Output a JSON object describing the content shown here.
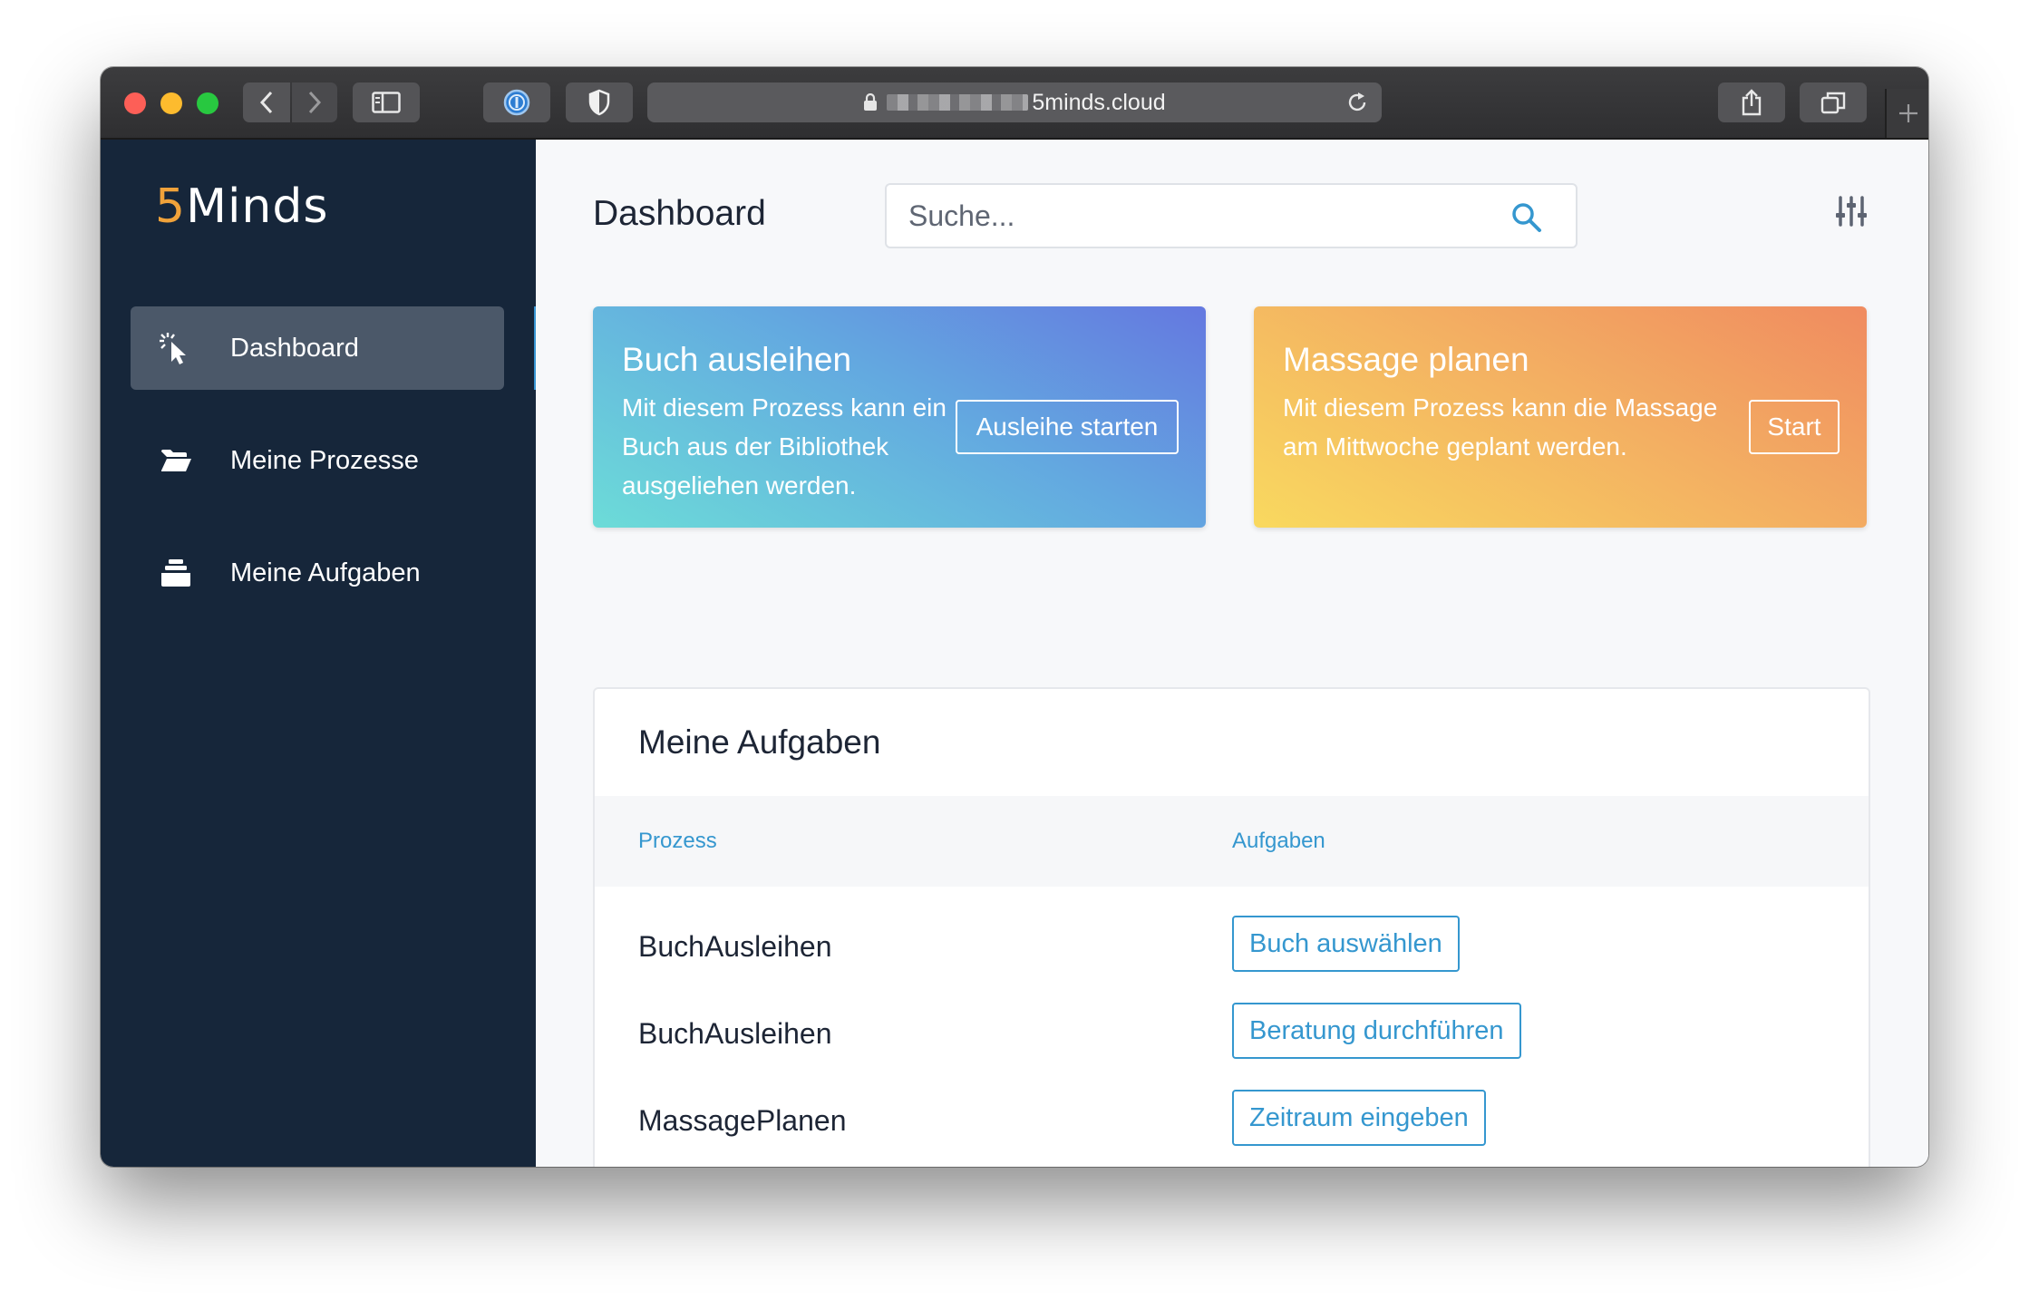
{
  "browser": {
    "url_domain": "5minds.cloud",
    "icons": [
      "back-icon",
      "forward-icon",
      "sidebar-toggle-icon",
      "password-manager-icon",
      "privacy-shield-icon",
      "lock-icon",
      "reload-icon",
      "share-icon",
      "tabs-icon",
      "new-tab-icon"
    ]
  },
  "sidebar": {
    "logo_number": "5",
    "logo_text": "Minds",
    "items": [
      {
        "label": "Dashboard",
        "icon": "cursor-click-icon",
        "active": true
      },
      {
        "label": "Meine Prozesse",
        "icon": "folder-open-icon",
        "active": false
      },
      {
        "label": "Meine Aufgaben",
        "icon": "inbox-stack-icon",
        "active": false
      }
    ]
  },
  "header": {
    "title": "Dashboard",
    "search_placeholder": "Suche...",
    "search_icon": "search-icon",
    "settings_icon": "sliders-icon"
  },
  "cards": [
    {
      "title": "Buch ausleihen",
      "text": "Mit diesem Prozess kann ein Buch aus der Bibliothek ausgeliehen werden.",
      "button": "Ausleihe starten"
    },
    {
      "title": "Massage planen",
      "text": "Mit diesem Prozess kann die Massage am Mittwoche geplant werden.",
      "button": "Start"
    }
  ],
  "tasks": {
    "title": "Meine Aufgaben",
    "columns": [
      "Prozess",
      "Aufgaben"
    ],
    "rows": [
      {
        "process": "BuchAusleihen",
        "task": "Buch auswählen"
      },
      {
        "process": "BuchAusleihen",
        "task": "Beratung durchführen"
      },
      {
        "process": "MassagePlanen",
        "task": "Zeitraum eingeben"
      }
    ]
  },
  "colors": {
    "sidebar_bg": "#16263a",
    "accent": "#3597cf",
    "logo_accent": "#f0a23a"
  }
}
